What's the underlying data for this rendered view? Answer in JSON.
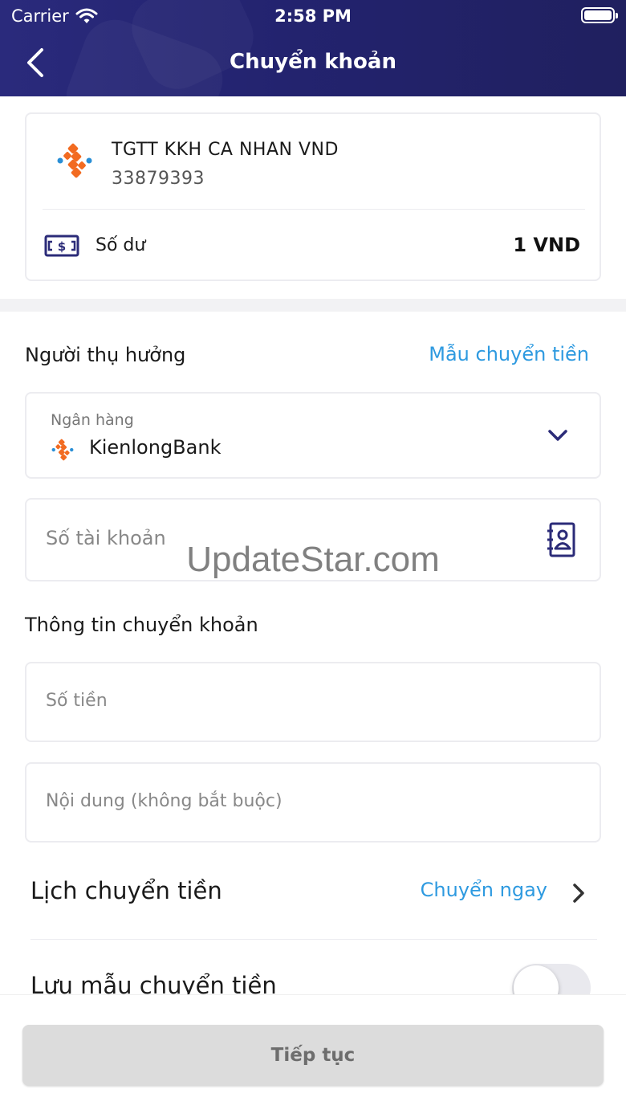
{
  "status_bar": {
    "carrier": "Carrier",
    "time": "2:58 PM"
  },
  "header": {
    "title": "Chuyển khoản"
  },
  "source_account": {
    "name": "TGTT KKH CA NHAN VND",
    "number": "33879393",
    "balance_label": "Số dư",
    "balance_value": "1 VND"
  },
  "beneficiary": {
    "section_title": "Người thụ hưởng",
    "template_link": "Mẫu chuyển tiền",
    "bank_caption": "Ngân hàng",
    "bank_name": "KienlongBank",
    "account_placeholder": "Số tài khoản"
  },
  "watermark": "UpdateStar.com",
  "transfer_info": {
    "section_title": "Thông tin chuyển khoản",
    "amount_placeholder": "Số tiền",
    "content_placeholder": "Nội dung (không bắt buộc)"
  },
  "schedule": {
    "label": "Lịch chuyển tiền",
    "value": "Chuyển ngay"
  },
  "save_template": {
    "label": "Lưu mẫu chuyển tiền",
    "enabled": false
  },
  "footer": {
    "continue_label": "Tiếp tục"
  },
  "colors": {
    "header_bg": "#23236f",
    "link_blue": "#2e9ae0",
    "brand_orange": "#f26b21",
    "brand_blue": "#2a8fd6",
    "icon_navy": "#2b2b78",
    "button_disabled": "#dcdcdc"
  },
  "icons": {
    "back": "chevron-left-icon",
    "bank_logo": "kienlongbank-logo-icon",
    "balance": "money-icon",
    "dropdown": "chevron-down-icon",
    "contacts": "contact-book-icon",
    "schedule_arrow": "chevron-right-icon",
    "wifi": "wifi-icon",
    "battery": "battery-icon"
  }
}
